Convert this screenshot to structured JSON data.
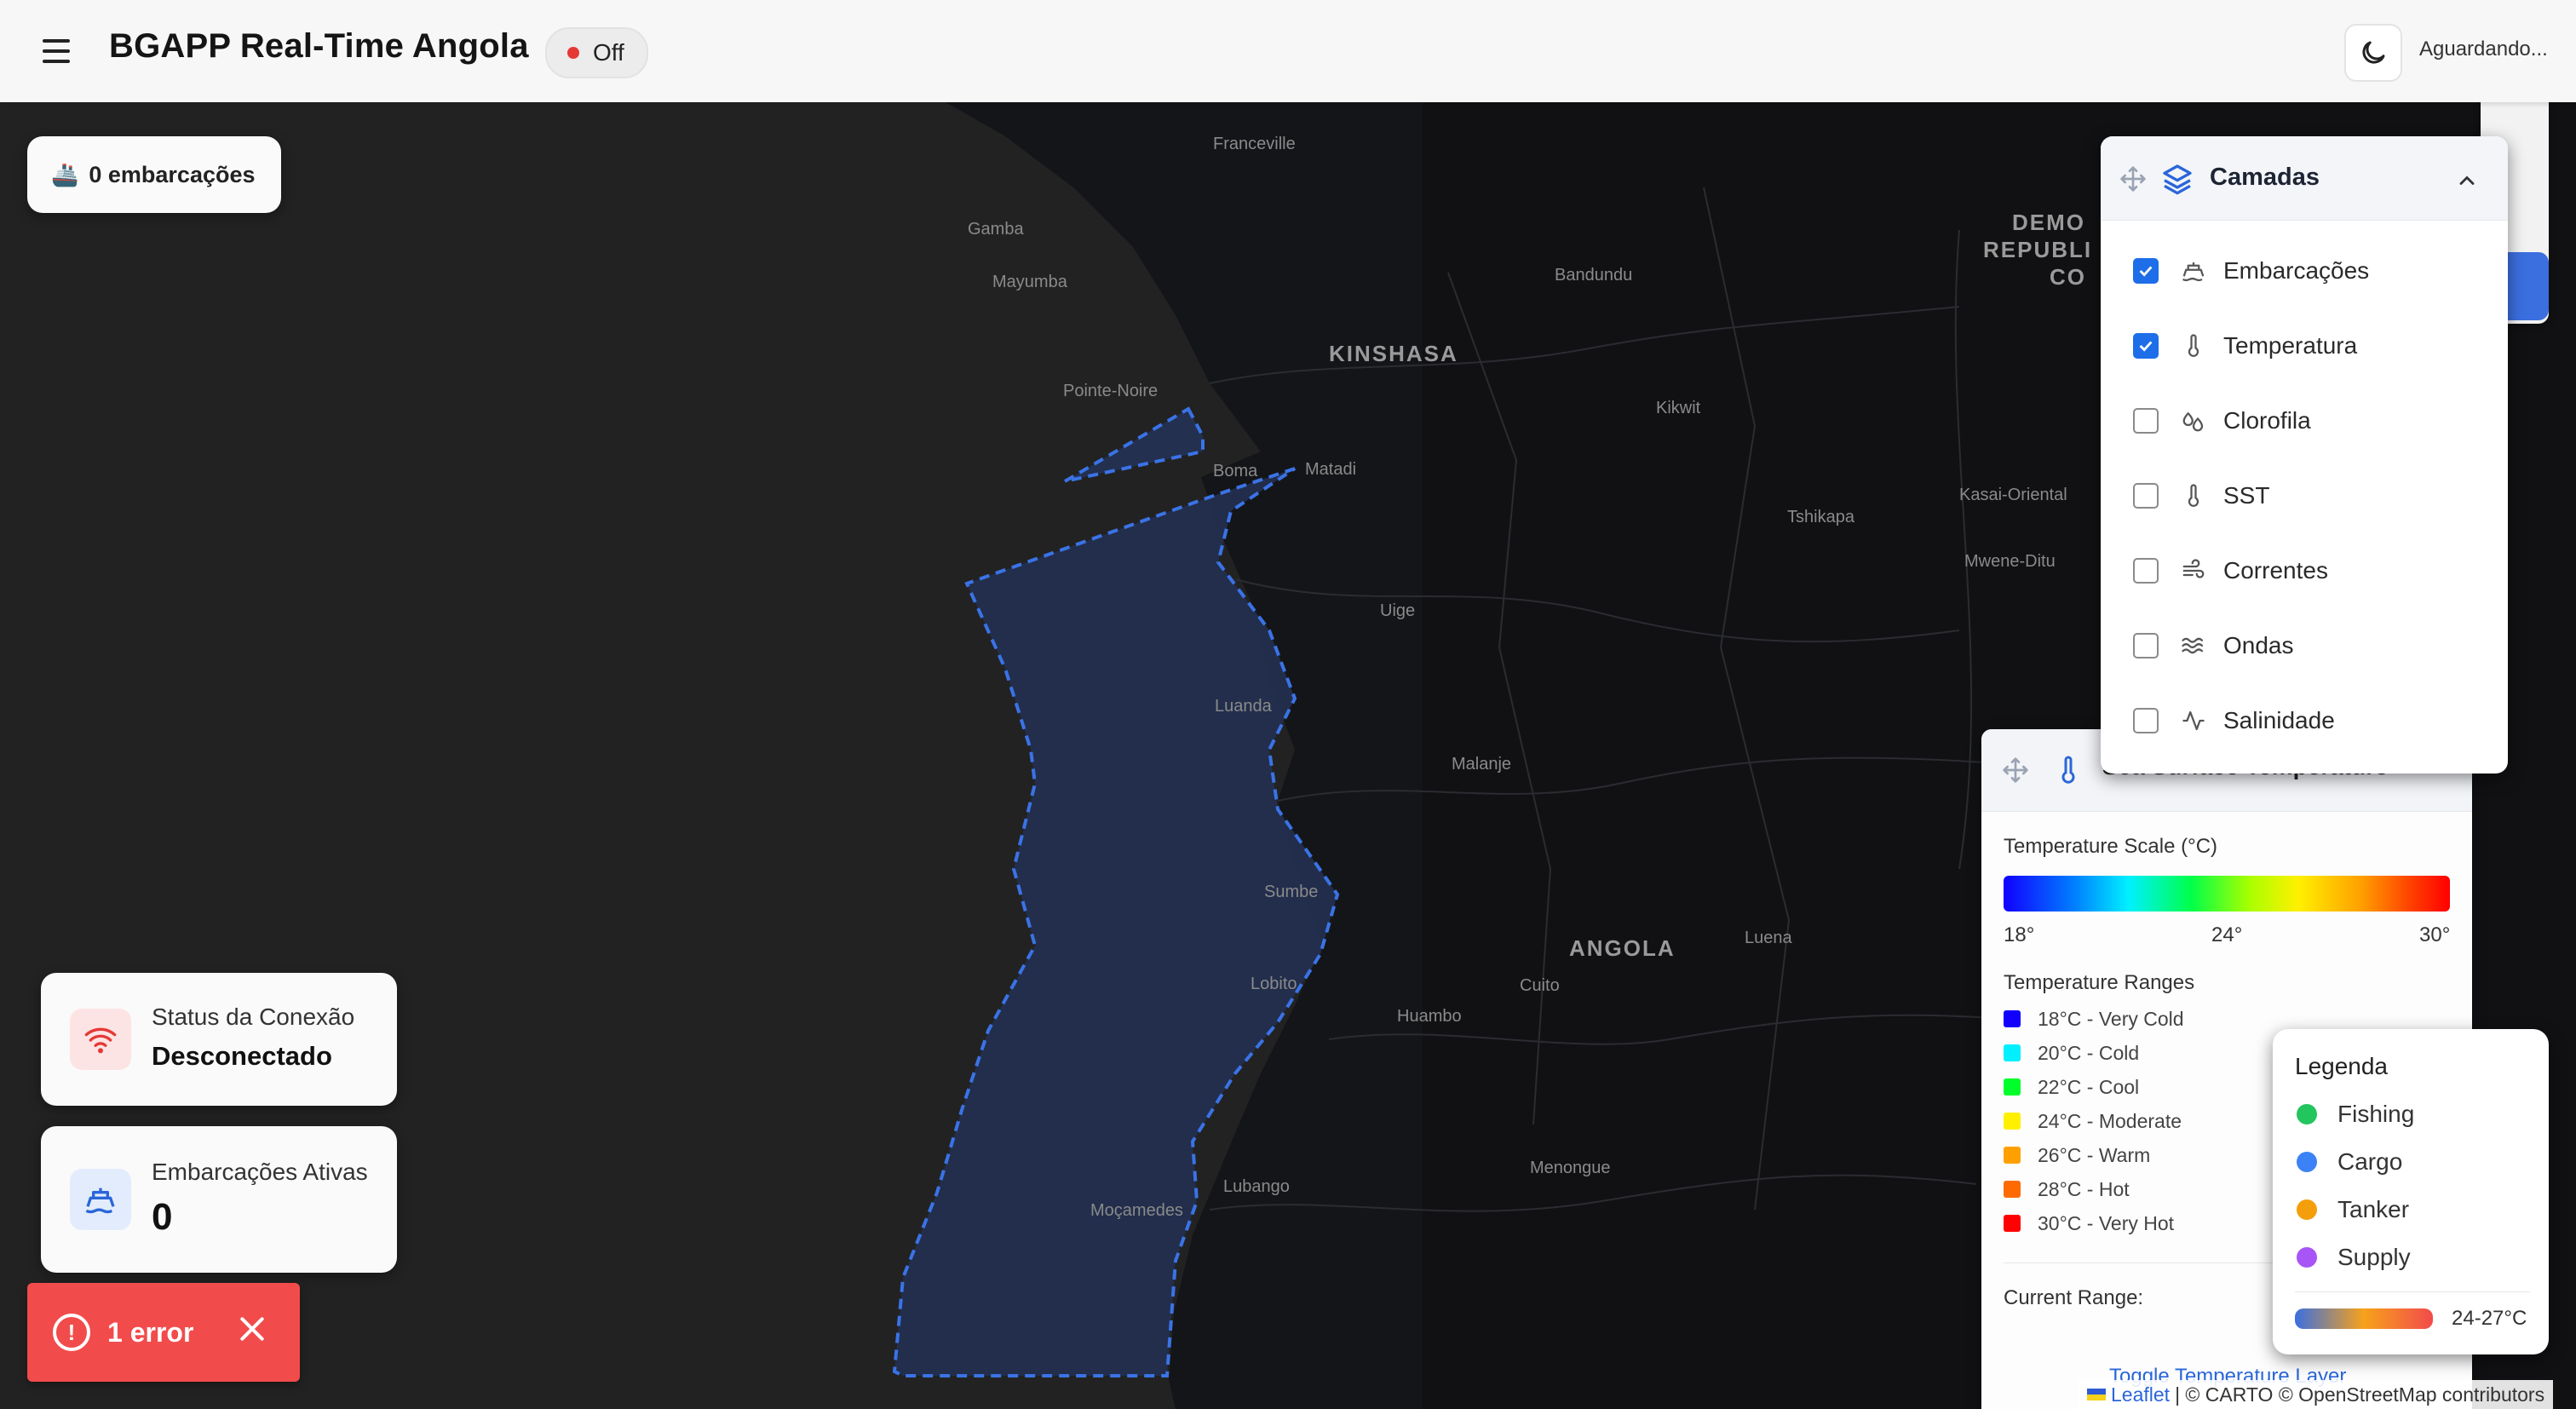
{
  "header": {
    "title": "BGAPP Real-Time Angola",
    "status_label": "Off",
    "waiting_label": "Aguardando..."
  },
  "map": {
    "labels": [
      "Franceville",
      "Gamba",
      "Mayumba",
      "Bandundu",
      "KINSHASA",
      "Pointe-Noire",
      "Boma",
      "Matadi",
      "Kikwit",
      "Kasai-Oriental",
      "Tshikapa",
      "Mwene-Ditu",
      "Uige",
      "Luanda",
      "Malanje",
      "Sumbe",
      "ANGOLA",
      "Luena",
      "Lobito",
      "Cuito",
      "Huambo",
      "Menongue",
      "Lubango",
      "Moçamedes",
      "DEMO",
      "REPUBLI",
      "CO"
    ]
  },
  "vessel_badge": {
    "label": "0 embarcações"
  },
  "connection": {
    "title": "Status da Conexão",
    "value": "Desconectado"
  },
  "active_vessels": {
    "title": "Embarcações Ativas",
    "value": "0"
  },
  "error_toast": {
    "label": "1 error"
  },
  "layers": {
    "title": "Camadas",
    "items": [
      {
        "label": "Embarcações",
        "checked": true,
        "icon": "ship-icon"
      },
      {
        "label": "Temperatura",
        "checked": true,
        "icon": "thermometer-icon"
      },
      {
        "label": "Clorofila",
        "checked": false,
        "icon": "droplets-icon"
      },
      {
        "label": "SST",
        "checked": false,
        "icon": "thermometer-icon"
      },
      {
        "label": "Correntes",
        "checked": false,
        "icon": "wind-icon"
      },
      {
        "label": "Ondas",
        "checked": false,
        "icon": "waves-icon"
      },
      {
        "label": "Salinidade",
        "checked": false,
        "icon": "activity-icon"
      }
    ]
  },
  "temperature": {
    "title": "Sea Surface Temperature",
    "scale_title": "Temperature Scale (°C)",
    "scale_min": "18°",
    "scale_mid": "24°",
    "scale_max": "30°",
    "ranges_title": "Temperature Ranges",
    "ranges": [
      {
        "label": "18°C - Very Cold",
        "color": "#1200ff"
      },
      {
        "label": "20°C - Cold",
        "color": "#00f0ff"
      },
      {
        "label": "22°C - Cool",
        "color": "#00ff2a"
      },
      {
        "label": "24°C - Moderate",
        "color": "#fff000"
      },
      {
        "label": "26°C - Warm",
        "color": "#ffa000"
      },
      {
        "label": "28°C - Hot",
        "color": "#ff6a00"
      },
      {
        "label": "30°C - Very Hot",
        "color": "#ff0000"
      }
    ],
    "current_range_label": "Current Range:",
    "toggle_label": "Toggle Temperature Layer"
  },
  "legend": {
    "title": "Legenda",
    "items": [
      {
        "label": "Fishing",
        "color": "#22c55e"
      },
      {
        "label": "Cargo",
        "color": "#3b82f6"
      },
      {
        "label": "Tanker",
        "color": "#f59e0b"
      },
      {
        "label": "Supply",
        "color": "#a855f7"
      }
    ],
    "range": "24-27°C"
  },
  "attribution": {
    "leaflet": "Leaflet",
    "text": "| © CARTO © OpenStreetMap contributors"
  }
}
